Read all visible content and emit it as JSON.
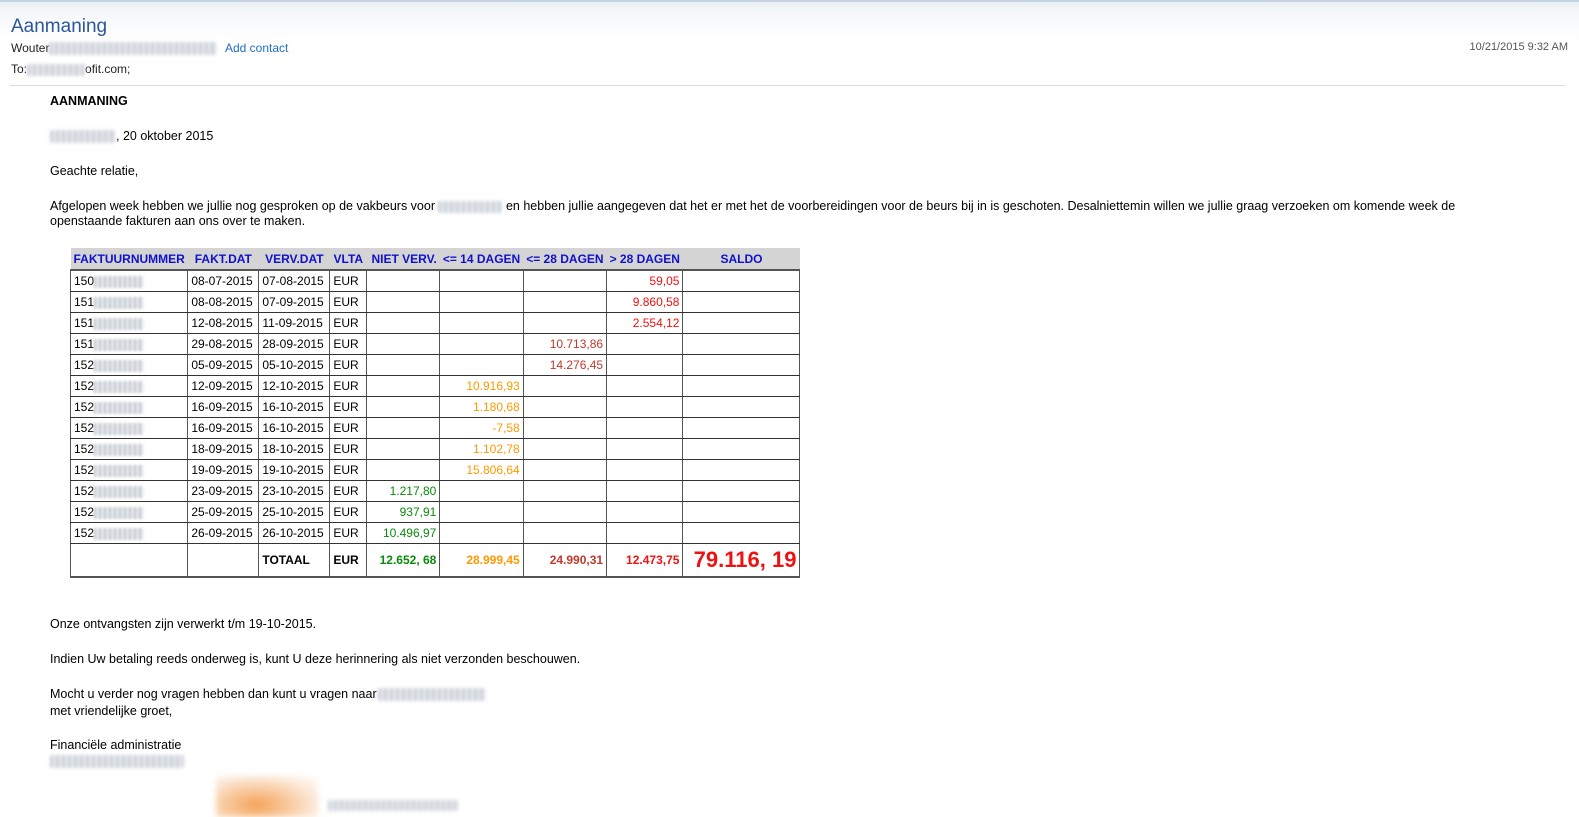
{
  "email": {
    "subject": "Aanmaning",
    "sender_name": "Wouter",
    "add_contact": "Add contact",
    "date": "10/21/2015 9:32 AM",
    "to_prefix": "To:",
    "to_suffix": "ofit.com;"
  },
  "letter": {
    "title": "AANMANING",
    "place_date": ", 20 oktober 2015",
    "greeting": "Geachte relatie,",
    "intro_a": "Afgelopen week hebben we jullie nog gesproken op de vakbeurs voor",
    "intro_b": "en hebben jullie aangegeven dat het er met het de voorbereidingen voor de beurs bij in is geschoten. Desalniettemin willen we jullie graag verzoeken om komende week de openstaande fakturen aan ons over te maken.",
    "ontvangsten": "Onze ontvangsten zijn verwerkt t/m 19-10-2015.",
    "indien": "Indien Uw betaling reeds onderweg is, kunt U deze herinnering als niet verzonden beschouwen.",
    "mocht": "Mocht u verder nog vragen hebben dan kunt u vragen naar",
    "groet": "met vriendelijke groet,",
    "financieel": "Financiële administratie"
  },
  "table": {
    "headers": [
      "FAKTUURNUMMER",
      "FAKT.DAT",
      "VERV.DAT",
      "VLTA",
      "NIET VERV.",
      "<= 14 DAGEN",
      "<= 28 DAGEN",
      "> 28 DAGEN",
      "SALDO"
    ],
    "rows": [
      {
        "nr": "150",
        "fakt": "08-07-2015",
        "verv": "07-08-2015",
        "vlta": "EUR",
        "niet": "",
        "d14": "",
        "d28": "",
        "gt28": "59,05"
      },
      {
        "nr": "151",
        "fakt": "08-08-2015",
        "verv": "07-09-2015",
        "vlta": "EUR",
        "niet": "",
        "d14": "",
        "d28": "",
        "gt28": "9.860,58"
      },
      {
        "nr": "151",
        "fakt": "12-08-2015",
        "verv": "11-09-2015",
        "vlta": "EUR",
        "niet": "",
        "d14": "",
        "d28": "",
        "gt28": "2.554,12"
      },
      {
        "nr": "151",
        "fakt": "29-08-2015",
        "verv": "28-09-2015",
        "vlta": "EUR",
        "niet": "",
        "d14": "",
        "d28": "10.713,86",
        "gt28": ""
      },
      {
        "nr": "152",
        "fakt": "05-09-2015",
        "verv": "05-10-2015",
        "vlta": "EUR",
        "niet": "",
        "d14": "",
        "d28": "14.276,45",
        "gt28": ""
      },
      {
        "nr": "152",
        "fakt": "12-09-2015",
        "verv": "12-10-2015",
        "vlta": "EUR",
        "niet": "",
        "d14": "10.916,93",
        "d28": "",
        "gt28": ""
      },
      {
        "nr": "152",
        "fakt": "16-09-2015",
        "verv": "16-10-2015",
        "vlta": "EUR",
        "niet": "",
        "d14": "1.180,68",
        "d28": "",
        "gt28": ""
      },
      {
        "nr": "152",
        "fakt": "16-09-2015",
        "verv": "16-10-2015",
        "vlta": "EUR",
        "niet": "",
        "d14": "-7,58",
        "d28": "",
        "gt28": ""
      },
      {
        "nr": "152",
        "fakt": "18-09-2015",
        "verv": "18-10-2015",
        "vlta": "EUR",
        "niet": "",
        "d14": "1.102,78",
        "d28": "",
        "gt28": ""
      },
      {
        "nr": "152",
        "fakt": "19-09-2015",
        "verv": "19-10-2015",
        "vlta": "EUR",
        "niet": "",
        "d14": "15.806,64",
        "d28": "",
        "gt28": ""
      },
      {
        "nr": "152",
        "fakt": "23-09-2015",
        "verv": "23-10-2015",
        "vlta": "EUR",
        "niet": "1.217,80",
        "d14": "",
        "d28": "",
        "gt28": ""
      },
      {
        "nr": "152",
        "fakt": "25-09-2015",
        "verv": "25-10-2015",
        "vlta": "EUR",
        "niet": "937,91",
        "d14": "",
        "d28": "",
        "gt28": ""
      },
      {
        "nr": "152",
        "fakt": "26-09-2015",
        "verv": "26-10-2015",
        "vlta": "EUR",
        "niet": "10.496,97",
        "d14": "",
        "d28": "",
        "gt28": ""
      }
    ],
    "total": {
      "label": "TOTAAL",
      "vlta": "EUR",
      "niet": "12.652, 68",
      "d14": "28.999,45",
      "d28": "24.990,31",
      "gt28": "12.473,75",
      "saldo": "79.116, 19"
    }
  },
  "colors": {
    "niet": "#0a8a0a",
    "d14": "#ff9900",
    "d28": "#c0392b",
    "gt28": "#ee1111",
    "header_text": "#1111cc"
  }
}
